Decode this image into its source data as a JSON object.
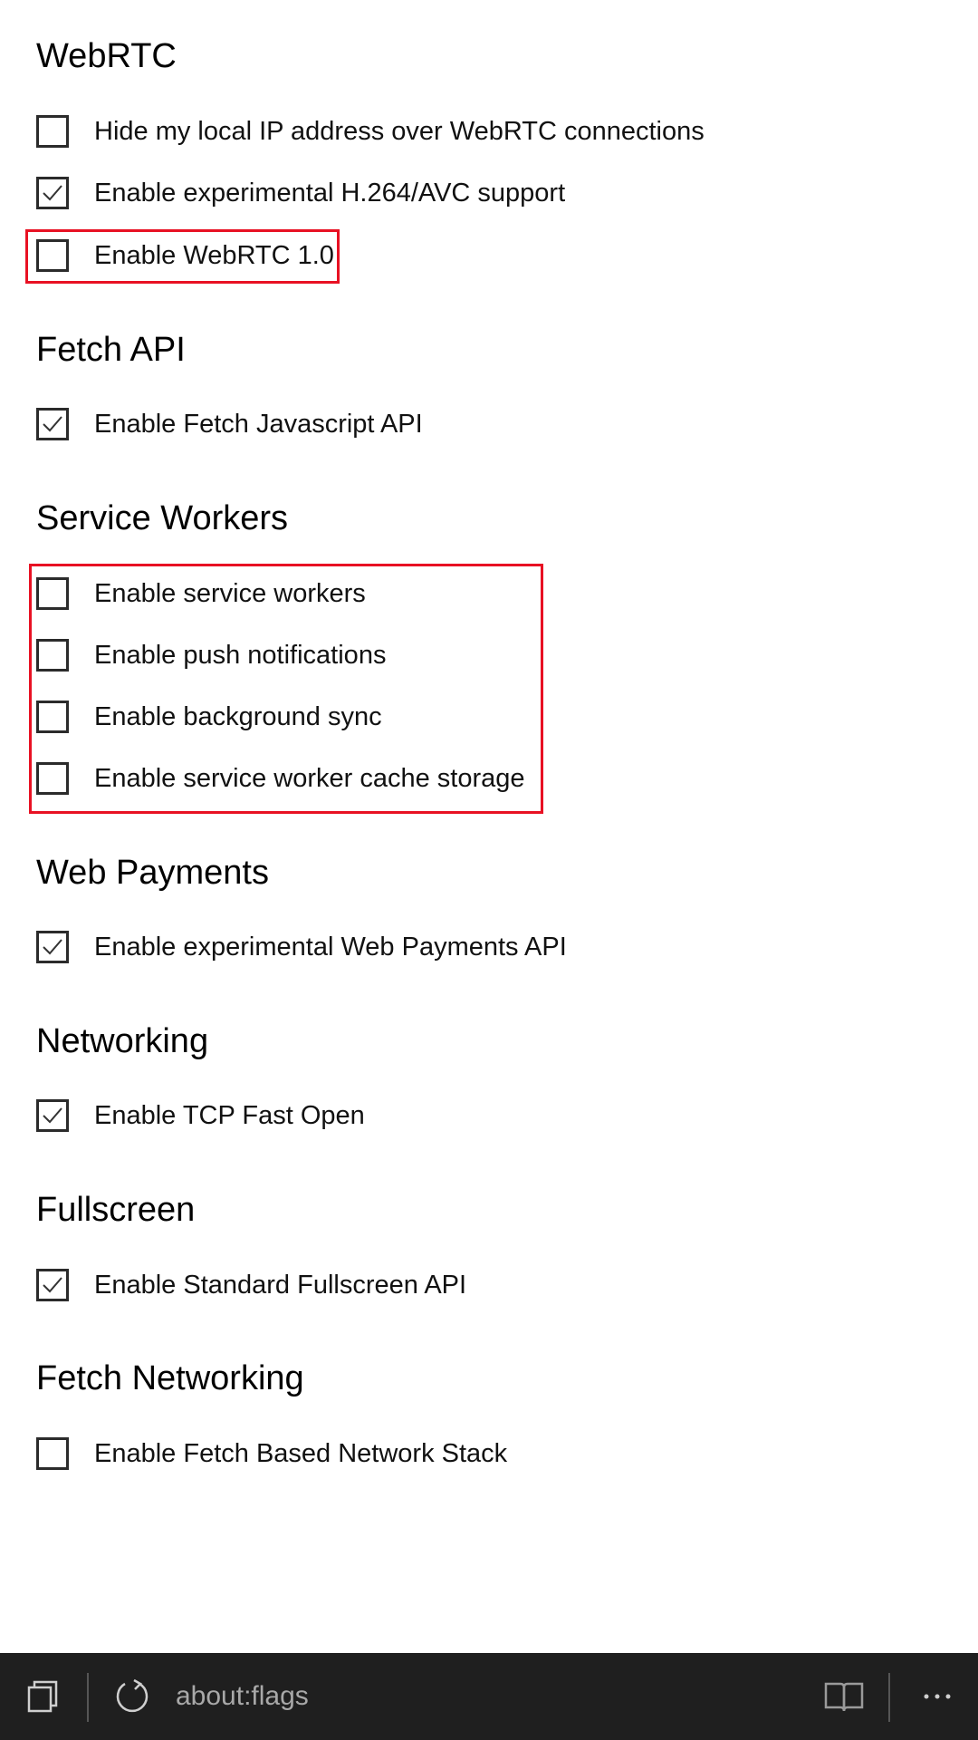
{
  "sections": [
    {
      "title": "WebRTC",
      "items": [
        {
          "label": "Hide my local IP address over WebRTC connections",
          "checked": false
        },
        {
          "label": "Enable experimental H.264/AVC support",
          "checked": true
        },
        {
          "label": "Enable WebRTC 1.0",
          "checked": false
        }
      ]
    },
    {
      "title": "Fetch API",
      "items": [
        {
          "label": "Enable Fetch Javascript API",
          "checked": true
        }
      ]
    },
    {
      "title": "Service Workers",
      "items": [
        {
          "label": "Enable service workers",
          "checked": false
        },
        {
          "label": "Enable push notifications",
          "checked": false
        },
        {
          "label": "Enable background sync",
          "checked": false
        },
        {
          "label": "Enable service worker cache storage",
          "checked": false
        }
      ]
    },
    {
      "title": "Web Payments",
      "items": [
        {
          "label": "Enable experimental Web Payments API",
          "checked": true
        }
      ]
    },
    {
      "title": "Networking",
      "items": [
        {
          "label": "Enable TCP Fast Open",
          "checked": true
        }
      ]
    },
    {
      "title": "Fullscreen",
      "items": [
        {
          "label": "Enable Standard Fullscreen API",
          "checked": true
        }
      ]
    },
    {
      "title": "Fetch Networking",
      "items": [
        {
          "label": "Enable Fetch Based Network Stack",
          "checked": false
        }
      ]
    }
  ],
  "address_bar": {
    "url": "about:flags"
  },
  "colors": {
    "highlight": "#e81123",
    "bar": "#1f1f1f"
  }
}
